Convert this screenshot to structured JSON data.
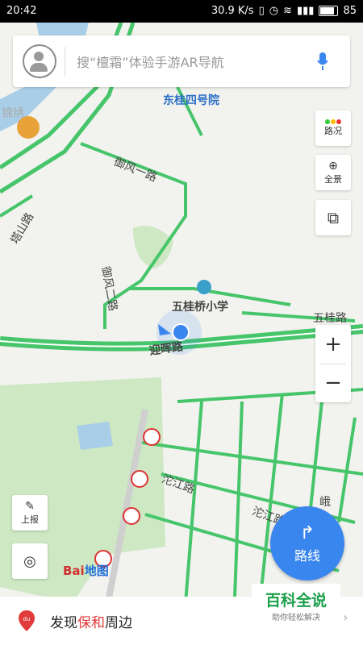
{
  "status_bar": {
    "time": "20:42",
    "speed": "30.9 K/s",
    "battery": "85"
  },
  "search": {
    "placeholder": "搜“檀霜”体验手游AR导航"
  },
  "side_buttons": {
    "traffic": "路况",
    "panorama": "全景"
  },
  "left_buttons": {
    "report": "上报"
  },
  "zoom": {
    "in": "+",
    "out": "−"
  },
  "route_button": {
    "label": "路线"
  },
  "logo": {
    "bai": "Bai",
    "du": "地图"
  },
  "bottom_bar": {
    "prefix": "发现",
    "highlight": "保和",
    "suffix": "周边"
  },
  "baike": {
    "title": "百科全说",
    "subtitle": "助你轻松解决"
  },
  "map_labels": {
    "donggui": "东桂四号院",
    "yufeng1": "御风一路",
    "yufeng2": "御风二路",
    "wuguiqiao": "五桂桥小学",
    "wuguilu": "五桂路",
    "yinghui": "迎晖路",
    "tuojiang": "沱江路",
    "tuojiang2": "沱江路",
    "tashan": "塔山路",
    "jinjiang": "锦绣",
    "mao": "峨"
  },
  "colors": {
    "road_green": "#46c56a",
    "accent": "#3a86ef",
    "water": "#a9cfe8",
    "park": "#cde8c3"
  }
}
